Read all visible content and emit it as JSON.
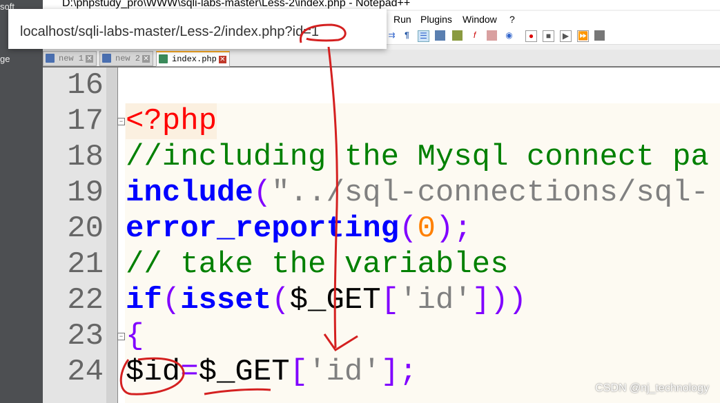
{
  "desktop": {
    "labels": [
      "soft",
      "ge"
    ]
  },
  "window": {
    "title": "D:\\phpstudy_pro\\WWW\\sqli-labs-master\\Less-2\\index.php - Notepad++"
  },
  "menu": [
    "Run",
    "Plugins",
    "Window",
    "?"
  ],
  "tabs": [
    {
      "label": "new 1"
    },
    {
      "label": "new 2"
    },
    {
      "label": "index.php"
    }
  ],
  "address_bar": {
    "url": "localhost/sqli-labs-master/Less-2/index.php?id=1"
  },
  "editor": {
    "lines": [
      {
        "n": "16"
      },
      {
        "n": "17"
      },
      {
        "n": "18"
      },
      {
        "n": "19"
      },
      {
        "n": "20"
      },
      {
        "n": "21"
      },
      {
        "n": "22"
      },
      {
        "n": "23"
      },
      {
        "n": "24"
      }
    ],
    "code": {
      "l17": "<?php",
      "l18": "//including the Mysql connect pa",
      "l19a": "include",
      "l19b": "(",
      "l19c": "\"../sql-connections/sql-",
      "l20a": "error_reporting",
      "l20b": "(",
      "l20c": "0",
      "l20d": ");",
      "l21": "// take the variables",
      "l22a": "if",
      "l22b": "(",
      "l22c": "isset",
      "l22d": "(",
      "l22e": "$_GET",
      "l22f": "[",
      "l22g": "'id'",
      "l22h": "]))",
      "l23": "{",
      "l24a": "$id",
      "l24b": "=",
      "l24c": "$_GET",
      "l24d": "[",
      "l24e": "'id'",
      "l24f": "];"
    }
  },
  "watermark": "CSDN @nj_technology"
}
